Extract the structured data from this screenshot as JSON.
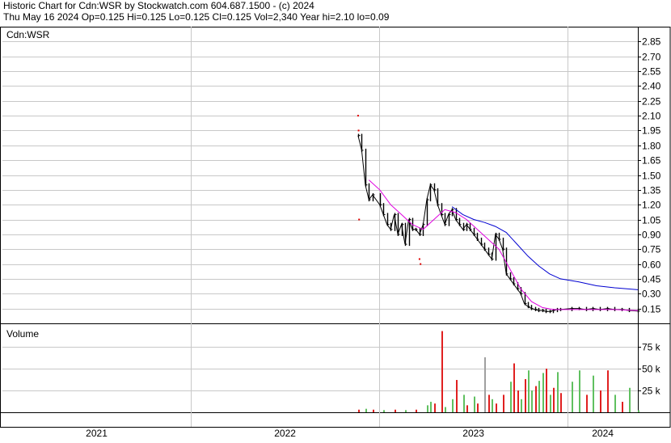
{
  "header": {
    "line1": "Historic Chart for Cdn:WSR by Stockwatch.com 604.687.1500 - (c) 2024",
    "line2": "Thu May 16 2024   Op=0.125   Hi=0.125   Lo=0.125   Cl=0.125   Vol=2,340   Year hi=2.10   lo=0.09"
  },
  "colors": {
    "background": "#ffffff",
    "grid": "#c8c8c8",
    "price_bar": "#000000",
    "ma_short": "#e000e0",
    "ma_long": "#0000d0",
    "vol_up": "#60c060",
    "vol_down": "#e02020",
    "vol_unch": "#a0a0a0",
    "extreme_dot": "#e00000"
  },
  "chart_data": [
    {
      "type": "line",
      "title": "Cdn:WSR",
      "y_ticks": [
        "0.15",
        "0.30",
        "0.45",
        "0.60",
        "0.75",
        "0.90",
        "1.05",
        "1.20",
        "1.35",
        "1.50",
        "1.65",
        "1.80",
        "1.95",
        "2.10",
        "2.25",
        "2.40",
        "2.55",
        "2.70",
        "2.85"
      ],
      "ylim": [
        0,
        3.0
      ],
      "x_axis_labels": [
        "2021",
        "2022",
        "2023",
        "2024"
      ],
      "x_range": [
        "2021-01-01",
        "2024-05-16"
      ],
      "series": [
        {
          "kind": "price_close",
          "points": [
            [
              "2022-11-21",
              1.9
            ],
            [
              "2022-11-28",
              1.75
            ],
            [
              "2022-12-05",
              1.4
            ],
            [
              "2022-12-12",
              1.25
            ],
            [
              "2022-12-19",
              1.3
            ],
            [
              "2023-01-02",
              1.2
            ],
            [
              "2023-01-09",
              1.1
            ],
            [
              "2023-01-16",
              1.0
            ],
            [
              "2023-01-23",
              0.95
            ],
            [
              "2023-01-30",
              1.1
            ],
            [
              "2023-02-06",
              0.9
            ],
            [
              "2023-02-13",
              1.0
            ],
            [
              "2023-02-20",
              0.8
            ],
            [
              "2023-02-27",
              1.05
            ],
            [
              "2023-03-06",
              0.95
            ],
            [
              "2023-03-13",
              0.95
            ],
            [
              "2023-03-20",
              0.9
            ],
            [
              "2023-03-27",
              1.0
            ],
            [
              "2023-04-03",
              1.25
            ],
            [
              "2023-04-10",
              1.4
            ],
            [
              "2023-04-17",
              1.35
            ],
            [
              "2023-04-24",
              1.2
            ],
            [
              "2023-05-01",
              1.1
            ],
            [
              "2023-05-08",
              1.0
            ],
            [
              "2023-05-15",
              1.1
            ],
            [
              "2023-05-22",
              1.15
            ],
            [
              "2023-05-29",
              1.05
            ],
            [
              "2023-06-05",
              1.0
            ],
            [
              "2023-06-12",
              0.95
            ],
            [
              "2023-06-19",
              1.0
            ],
            [
              "2023-06-26",
              0.95
            ],
            [
              "2023-07-03",
              0.9
            ],
            [
              "2023-07-10",
              0.85
            ],
            [
              "2023-07-17",
              0.8
            ],
            [
              "2023-07-24",
              0.75
            ],
            [
              "2023-07-31",
              0.7
            ],
            [
              "2023-08-07",
              0.65
            ],
            [
              "2023-08-14",
              0.9
            ],
            [
              "2023-08-21",
              0.85
            ],
            [
              "2023-08-28",
              0.75
            ],
            [
              "2023-09-04",
              0.5
            ],
            [
              "2023-09-11",
              0.45
            ],
            [
              "2023-09-18",
              0.4
            ],
            [
              "2023-09-25",
              0.35
            ],
            [
              "2023-10-02",
              0.3
            ],
            [
              "2023-10-09",
              0.2
            ],
            [
              "2023-10-16",
              0.17
            ],
            [
              "2023-10-23",
              0.15
            ],
            [
              "2023-10-30",
              0.14
            ],
            [
              "2023-11-06",
              0.13
            ],
            [
              "2023-11-13",
              0.13
            ],
            [
              "2023-11-20",
              0.12
            ],
            [
              "2023-11-27",
              0.12
            ],
            [
              "2023-12-04",
              0.13
            ],
            [
              "2023-12-11",
              0.14
            ],
            [
              "2023-12-18",
              0.14
            ],
            [
              "2024-01-08",
              0.15
            ],
            [
              "2024-01-22",
              0.15
            ],
            [
              "2024-02-05",
              0.14
            ],
            [
              "2024-02-19",
              0.15
            ],
            [
              "2024-03-04",
              0.14
            ],
            [
              "2024-03-18",
              0.15
            ],
            [
              "2024-04-01",
              0.14
            ],
            [
              "2024-04-15",
              0.14
            ],
            [
              "2024-04-29",
              0.13
            ],
            [
              "2024-05-16",
              0.125
            ]
          ]
        },
        {
          "kind": "moving_average_short",
          "points": [
            [
              "2022-12-12",
              1.45
            ],
            [
              "2023-01-02",
              1.35
            ],
            [
              "2023-01-23",
              1.2
            ],
            [
              "2023-02-13",
              1.1
            ],
            [
              "2023-03-06",
              1.0
            ],
            [
              "2023-03-27",
              0.95
            ],
            [
              "2023-04-17",
              1.05
            ],
            [
              "2023-05-08",
              1.15
            ],
            [
              "2023-05-29",
              1.12
            ],
            [
              "2023-06-19",
              1.05
            ],
            [
              "2023-07-10",
              0.95
            ],
            [
              "2023-07-31",
              0.85
            ],
            [
              "2023-08-21",
              0.75
            ],
            [
              "2023-09-11",
              0.55
            ],
            [
              "2023-10-02",
              0.35
            ],
            [
              "2023-10-23",
              0.22
            ],
            [
              "2023-11-13",
              0.16
            ],
            [
              "2023-12-04",
              0.14
            ],
            [
              "2024-01-08",
              0.14
            ],
            [
              "2024-02-05",
              0.14
            ],
            [
              "2024-03-04",
              0.14
            ],
            [
              "2024-04-01",
              0.14
            ],
            [
              "2024-05-16",
              0.13
            ]
          ]
        },
        {
          "kind": "moving_average_long",
          "points": [
            [
              "2023-05-22",
              1.18
            ],
            [
              "2023-06-12",
              1.1
            ],
            [
              "2023-07-03",
              1.05
            ],
            [
              "2023-07-24",
              1.02
            ],
            [
              "2023-08-14",
              0.98
            ],
            [
              "2023-09-04",
              0.92
            ],
            [
              "2023-09-25",
              0.8
            ],
            [
              "2023-10-16",
              0.68
            ],
            [
              "2023-11-06",
              0.58
            ],
            [
              "2023-11-27",
              0.5
            ],
            [
              "2023-12-18",
              0.45
            ],
            [
              "2024-01-22",
              0.42
            ],
            [
              "2024-02-26",
              0.38
            ],
            [
              "2024-04-01",
              0.36
            ],
            [
              "2024-05-16",
              0.34
            ]
          ]
        }
      ],
      "extremes": [
        [
          "2022-11-21",
          2.1
        ],
        [
          "2022-11-22",
          1.95
        ],
        [
          "2022-11-23",
          1.05
        ],
        [
          "2023-03-20",
          0.65
        ],
        [
          "2023-03-22",
          0.6
        ]
      ]
    },
    {
      "type": "bar",
      "title": "Volume",
      "y_ticks": [
        "25 k",
        "50 k",
        "75 k"
      ],
      "ylim": [
        0,
        100000
      ],
      "bars": [
        [
          "2022-11-21",
          3000,
          "down"
        ],
        [
          "2022-12-05",
          4000,
          "up"
        ],
        [
          "2022-12-19",
          3000,
          "down"
        ],
        [
          "2023-01-09",
          2500,
          "up"
        ],
        [
          "2023-01-30",
          3000,
          "down"
        ],
        [
          "2023-02-20",
          2500,
          "up"
        ],
        [
          "2023-03-13",
          3000,
          "down"
        ],
        [
          "2023-04-03",
          8000,
          "up"
        ],
        [
          "2023-04-10",
          12000,
          "up"
        ],
        [
          "2023-04-17",
          10000,
          "down"
        ],
        [
          "2023-05-01",
          93000,
          "down"
        ],
        [
          "2023-05-08",
          6000,
          "up"
        ],
        [
          "2023-05-22",
          15000,
          "up"
        ],
        [
          "2023-05-29",
          37000,
          "down"
        ],
        [
          "2023-06-12",
          20000,
          "up"
        ],
        [
          "2023-06-19",
          8000,
          "down"
        ],
        [
          "2023-07-03",
          18000,
          "up"
        ],
        [
          "2023-07-10",
          10000,
          "down"
        ],
        [
          "2023-07-24",
          63000,
          "unch"
        ],
        [
          "2023-07-31",
          20000,
          "down"
        ],
        [
          "2023-08-07",
          15000,
          "up"
        ],
        [
          "2023-08-14",
          10000,
          "down"
        ],
        [
          "2023-08-28",
          20000,
          "down"
        ],
        [
          "2023-09-11",
          35000,
          "up"
        ],
        [
          "2023-09-18",
          56000,
          "down"
        ],
        [
          "2023-09-25",
          25000,
          "down"
        ],
        [
          "2023-10-02",
          15000,
          "up"
        ],
        [
          "2023-10-09",
          38000,
          "down"
        ],
        [
          "2023-10-16",
          48000,
          "up"
        ],
        [
          "2023-10-23",
          25000,
          "up"
        ],
        [
          "2023-10-30",
          30000,
          "down"
        ],
        [
          "2023-11-06",
          36000,
          "up"
        ],
        [
          "2023-11-13",
          45000,
          "up"
        ],
        [
          "2023-11-20",
          50000,
          "down"
        ],
        [
          "2023-11-27",
          20000,
          "up"
        ],
        [
          "2023-12-04",
          28000,
          "down"
        ],
        [
          "2023-12-11",
          46000,
          "up"
        ],
        [
          "2023-12-18",
          22000,
          "down"
        ],
        [
          "2024-01-08",
          35000,
          "up"
        ],
        [
          "2024-01-22",
          48000,
          "up"
        ],
        [
          "2024-02-05",
          20000,
          "down"
        ],
        [
          "2024-02-19",
          42000,
          "up"
        ],
        [
          "2024-03-04",
          25000,
          "down"
        ],
        [
          "2024-03-18",
          48000,
          "down"
        ],
        [
          "2024-04-01",
          20000,
          "up"
        ],
        [
          "2024-04-15",
          12000,
          "down"
        ],
        [
          "2024-04-29",
          28000,
          "up"
        ],
        [
          "2024-05-16",
          2340,
          "up"
        ]
      ]
    }
  ]
}
